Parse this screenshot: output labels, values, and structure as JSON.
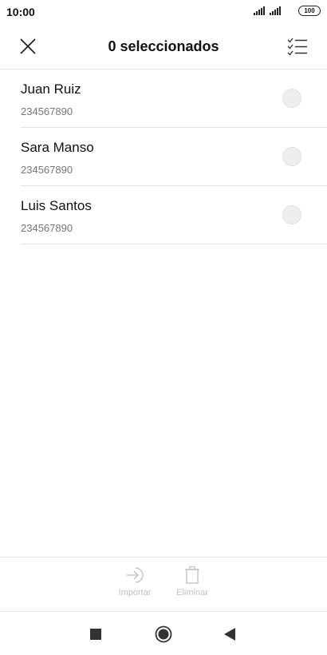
{
  "status_bar": {
    "time": "10:00",
    "battery": "100"
  },
  "header": {
    "title": "0 seleccionados"
  },
  "contacts": [
    {
      "name": "Juan Ruiz",
      "phone": "234567890"
    },
    {
      "name": "Sara Manso",
      "phone": "234567890"
    },
    {
      "name": "Luis Santos",
      "phone": "234567890"
    }
  ],
  "actions": {
    "import_label": "Importar",
    "delete_label": "Eliminar"
  },
  "icons": {
    "close": "close-icon",
    "select_all": "checklist-icon",
    "import": "import-arrow-icon",
    "delete": "trash-icon",
    "recents": "square-icon",
    "home": "circle-icon",
    "back": "triangle-back-icon"
  }
}
